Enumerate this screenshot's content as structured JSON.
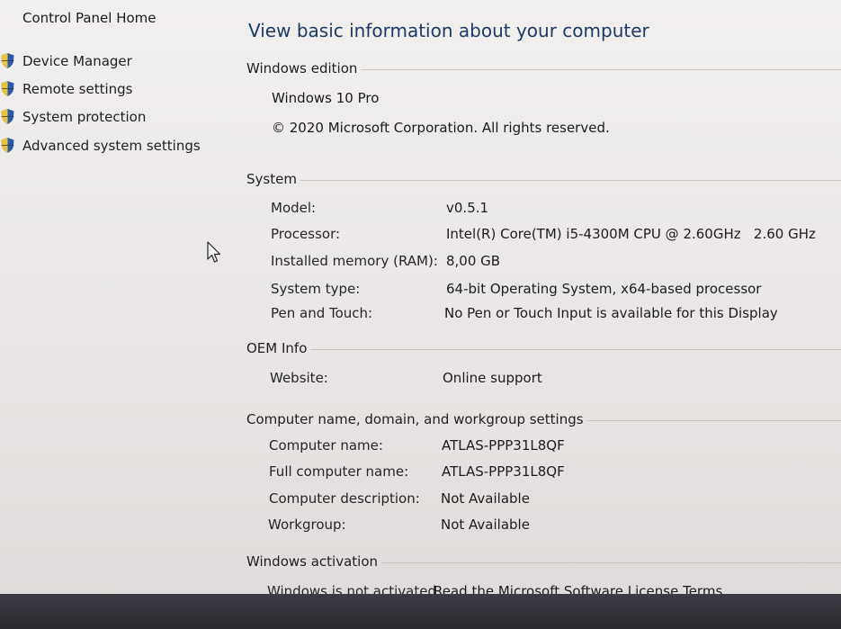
{
  "sidebar": {
    "home_label": "Control Panel Home",
    "items": [
      {
        "label": "Device Manager",
        "icon": "shield-icon"
      },
      {
        "label": "Remote settings",
        "icon": "shield-icon"
      },
      {
        "label": "System protection",
        "icon": "shield-icon"
      },
      {
        "label": "Advanced system settings",
        "icon": "shield-icon"
      }
    ]
  },
  "main": {
    "title": "View basic information about your computer",
    "edition": {
      "heading": "Windows edition",
      "name": "Windows 10 Pro",
      "copyright": "© 2020 Microsoft Corporation. All rights reserved."
    },
    "system": {
      "heading": "System",
      "rows": [
        {
          "label": "Model:",
          "value": "v0.5.1"
        },
        {
          "label": "Processor:",
          "value": "Intel(R) Core(TM) i5-4300M CPU @ 2.60GHz   2.60 GHz"
        },
        {
          "label": "Installed memory (RAM):",
          "value": "8,00 GB"
        },
        {
          "label": "System type:",
          "value": "64-bit Operating System, x64-based processor"
        },
        {
          "label": "Pen and Touch:",
          "value": "No Pen or Touch Input is available for this Display"
        }
      ]
    },
    "oem": {
      "heading": "OEM Info",
      "website_label": "Website:",
      "website_link": "Online support"
    },
    "computer_name": {
      "heading": "Computer name, domain, and workgroup settings",
      "rows": [
        {
          "label": "Computer name:",
          "value": "ATLAS-PPP31L8QF"
        },
        {
          "label": "Full computer name:",
          "value": "ATLAS-PPP31L8QF"
        },
        {
          "label": "Computer description:",
          "value": "Not Available"
        },
        {
          "label": "Workgroup:",
          "value": "Not Available"
        }
      ]
    },
    "activation": {
      "heading": "Windows activation",
      "status": "Windows is not activated.",
      "license_link": "Read the Microsoft Software License Terms"
    }
  },
  "colors": {
    "title": "#1e3a64",
    "link": "#3a7fc6",
    "background": "#eae7e6",
    "taskbar": "#2f2e35"
  }
}
